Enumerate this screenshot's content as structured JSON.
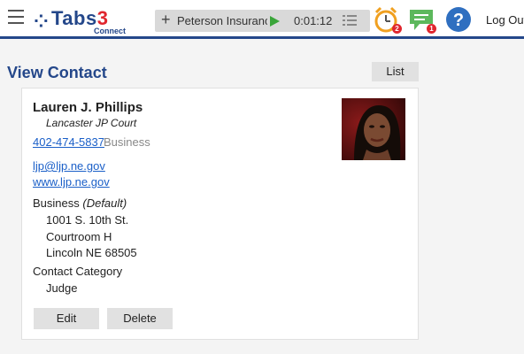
{
  "header": {
    "logo_text": "Tabs",
    "logo_number": "3",
    "logo_sub": "Connect",
    "timer": {
      "client": "Peterson Insuranc",
      "elapsed": "0:01:12"
    },
    "reminders_count": "2",
    "messages_count": "1",
    "logout_label": "Log Out",
    "icons": [
      "menu-icon",
      "plus-icon",
      "play-icon",
      "list-icon",
      "alarm-clock-icon",
      "message-icon",
      "help-icon"
    ]
  },
  "page": {
    "title": "View Contact",
    "list_button": "List"
  },
  "contact": {
    "name": "Lauren J. Phillips",
    "company": "Lancaster JP Court",
    "phone": "402-474-5837",
    "phone_type": "Business",
    "email": "ljp@ljp.ne.gov",
    "website": "www.ljp.ne.gov",
    "address_type": "Business",
    "address_default": "(Default)",
    "address_lines": [
      "1001 S. 10th St.",
      "Courtroom H",
      "Lincoln NE 68505"
    ],
    "category_label": "Contact Category",
    "category_value": "Judge",
    "edit_button": "Edit",
    "delete_button": "Delete"
  },
  "colors": {
    "brand_blue": "#24478a",
    "brand_red": "#e0262e",
    "link": "#1a5fc8",
    "play_green": "#3aa53a",
    "message_green": "#5cb85c",
    "help_blue": "#2f6fc0"
  }
}
